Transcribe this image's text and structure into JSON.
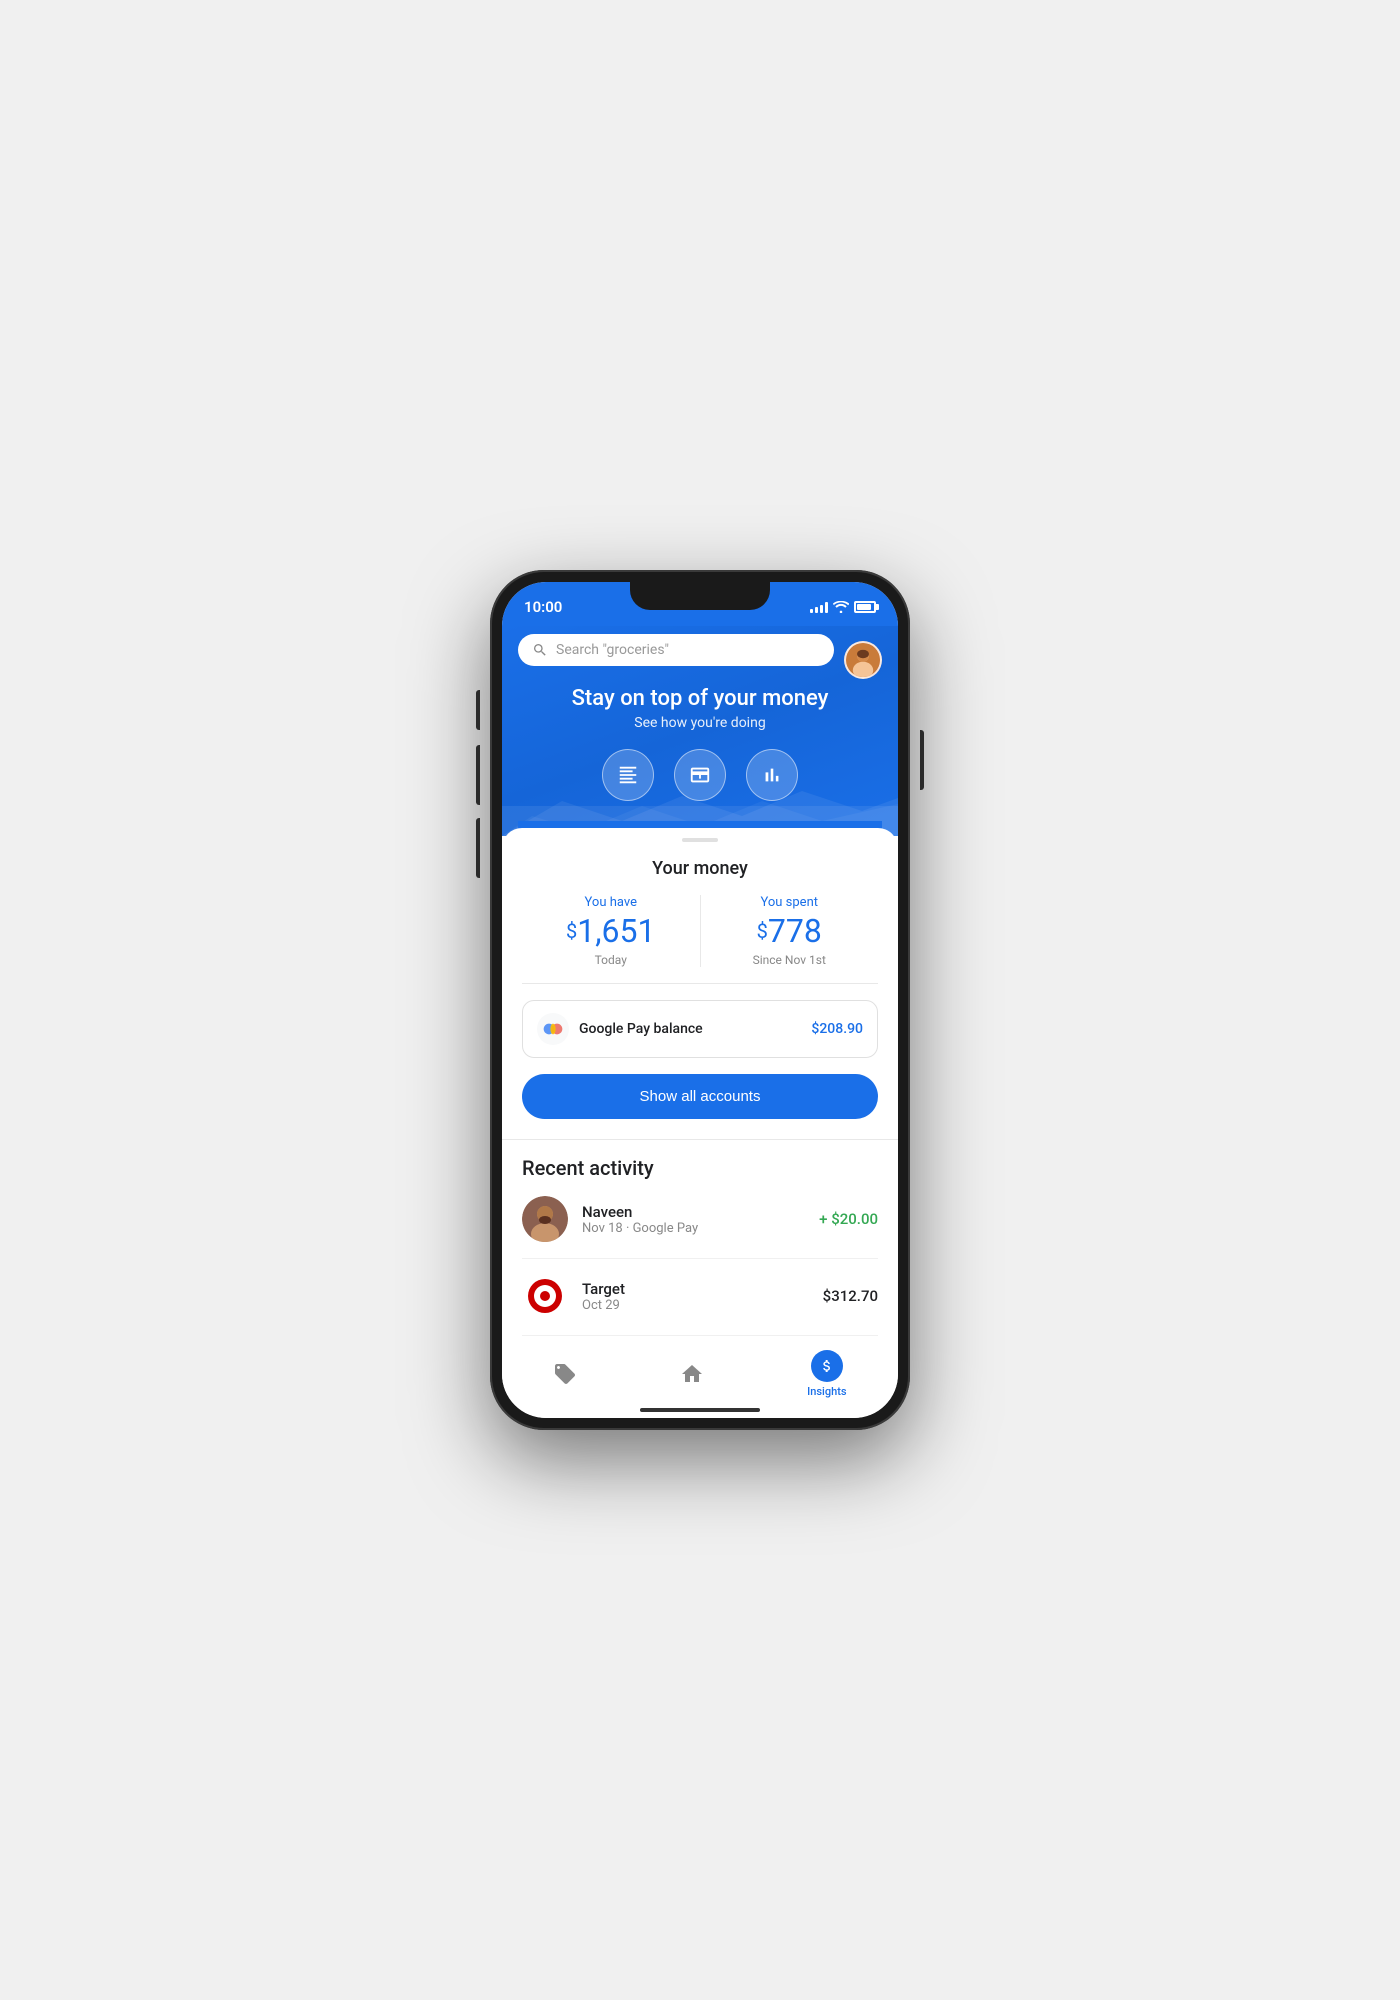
{
  "statusBar": {
    "time": "10:00"
  },
  "header": {
    "searchPlaceholder": "Search \"groceries\"",
    "heroTitle": "Stay on top of your money",
    "heroSubtitle": "See how you're doing"
  },
  "quickActions": [
    {
      "icon": "☰",
      "name": "transactions"
    },
    {
      "icon": "✦",
      "name": "pay"
    },
    {
      "icon": "⊞",
      "name": "insights"
    }
  ],
  "moneySection": {
    "title": "Your money",
    "youHave": {
      "label": "You have",
      "amount": "1,651",
      "sublabel": "Today"
    },
    "youSpent": {
      "label": "You spent",
      "amount": "778",
      "sublabel": "Since Nov 1st"
    },
    "googlePayBalance": {
      "label": "Google Pay balance",
      "amount": "$208.90"
    },
    "showAllButton": "Show all accounts"
  },
  "recentActivity": {
    "title": "Recent activity",
    "items": [
      {
        "name": "Naveen",
        "sub": "Nov 18 · Google Pay",
        "amount": "+ $20.00",
        "amountType": "positive"
      },
      {
        "name": "Target",
        "sub": "Oct 29",
        "amount": "$312.70",
        "amountType": "neutral"
      }
    ]
  },
  "bottomNav": [
    {
      "label": "",
      "icon": "tag",
      "active": false
    },
    {
      "label": "",
      "icon": "home",
      "active": false
    },
    {
      "label": "Insights",
      "icon": "dollar",
      "active": true
    }
  ]
}
